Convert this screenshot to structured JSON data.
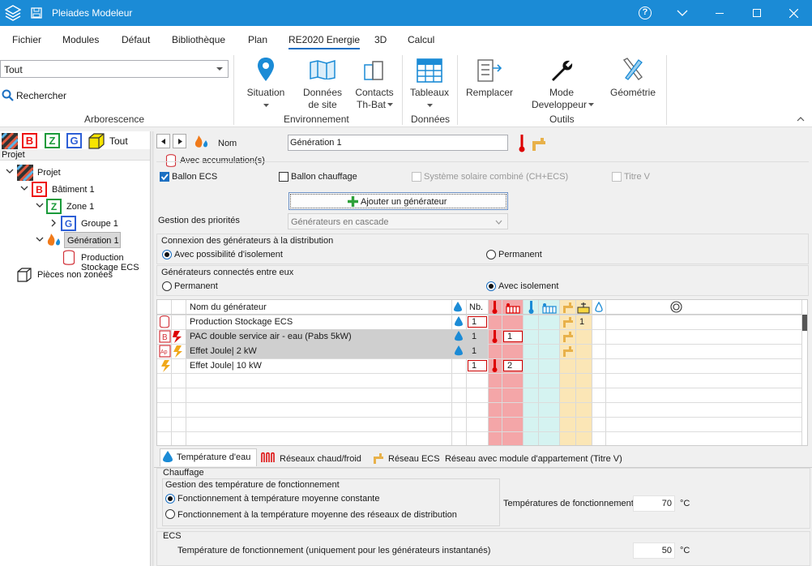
{
  "app": {
    "title": "Pleiades Modeleur",
    "help_icon": "?"
  },
  "menu": {
    "tabs": [
      "Fichier",
      "Modules",
      "Défaut",
      "Bibliothèque",
      "Plan",
      "RE2020 Energie",
      "3D",
      "Calcul"
    ]
  },
  "ribbon": {
    "tree_select": "Tout",
    "search": "Rechercher",
    "arbo_label": "Arborescence",
    "situation": "Situation",
    "donnees1": "Données",
    "donnees2": "de site",
    "contacts1": "Contacts",
    "contacts2": "Th-Bat",
    "env_label": "Environnement",
    "tableaux": "Tableaux",
    "donnees_label": "Données",
    "remplacer": "Remplacer",
    "mode1": "Mode",
    "mode2": "Developpeur",
    "geometrie": "Géométrie",
    "outils_label": "Outils"
  },
  "left": {
    "filters": [
      "B",
      "Z",
      "G"
    ],
    "tout": "Tout",
    "projet_header": "Projet",
    "tree": {
      "projet": "Projet",
      "batiment": "Bâtiment 1",
      "zone": "Zone 1",
      "groupe": "Groupe 1",
      "generation": "Génération 1",
      "production": "Production Stockage ECS",
      "pieces": "Pièces non zonées"
    }
  },
  "form": {
    "nom_label": "Nom",
    "nom_value": "Génération 1",
    "accumulation": "Avec accumulation(s)",
    "ballon_ecs": "Ballon ECS",
    "ballon_chauffage": "Ballon chauffage",
    "ssc": "Système solaire combiné (CH+ECS)",
    "titre_v": "Titre V",
    "add_generator": "Ajouter un générateur",
    "priorites_label": "Gestion des priorités",
    "priorites_value": "Générateurs en cascade",
    "connexion_title": "Connexion des générateurs à la distribution",
    "connexion_opt1": "Avec possibilité d'isolement",
    "connexion_opt2": "Permanent",
    "connectes_title": "Générateurs connectés entre eux",
    "connectes_opt1": "Permanent",
    "connectes_opt2": "Avec isolement"
  },
  "grid": {
    "col_name": "Nom du générateur",
    "col_nb": "Nb.",
    "rows": [
      {
        "name": "Production Stockage ECS",
        "nb": "1",
        "red": "",
        "col_ecs": "1",
        "selected": false,
        "boxnb": true
      },
      {
        "name": "PAC double service air - eau (Pabs 5kW)",
        "nb": "1",
        "red": "1",
        "col_ecs": "",
        "selected": true,
        "boxnb": false
      },
      {
        "name": "Effet Joule| 2 kW",
        "nb": "1",
        "red": "",
        "col_ecs": "",
        "selected": true,
        "boxnb": false
      },
      {
        "name": "Effet Joule| 10 kW",
        "nb": "1",
        "red": "2",
        "col_ecs": "",
        "selected": false,
        "boxnb": true
      }
    ]
  },
  "bottom": {
    "tabs": [
      "Température d'eau",
      "Réseaux chaud/froid",
      "Réseau ECS",
      "Réseau avec module d'appartement (Titre V)"
    ],
    "chauffage": "Chauffage",
    "gestion_title": "Gestion des température de fonctionnement",
    "opt1": "Fonctionnement à température moyenne constante",
    "opt2": "Fonctionnement à la température moyenne des réseaux de distribution",
    "temp_label": "Températures de fonctionnement",
    "temp_value": "70",
    "unit": "°C",
    "ecs": "ECS",
    "ecs_label": "Température de fonctionnement (uniquement pour les générateurs instantanés)",
    "ecs_value": "50"
  },
  "colors": {
    "titlebar": "#1b8bd6",
    "red_col": "#f4a6a8",
    "cyan_col": "#d5f3f1",
    "yellow_col": "#fbe6b6",
    "selected_row": "#cfcfcf"
  }
}
